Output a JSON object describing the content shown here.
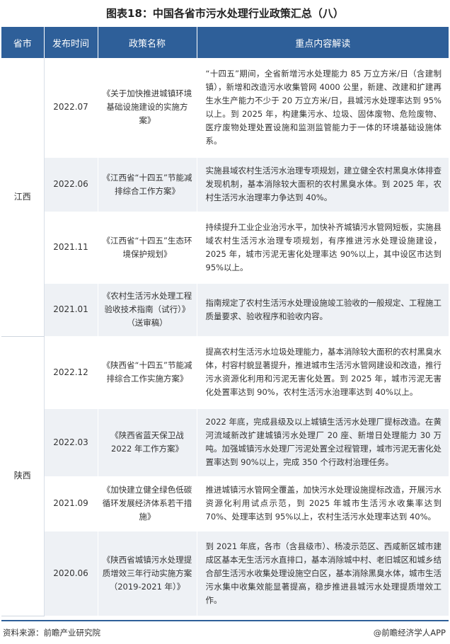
{
  "title": "图表18：中国各省市污水处理行业政策汇总（八）",
  "header": {
    "province": "省市",
    "date": "发布时间",
    "policy": "政策名称",
    "content": "重点内容解读"
  },
  "rows": [
    {
      "province": "江西",
      "date": "2022.07",
      "policy": "《关于加快推进城镇环境基础设施建设的实施方案》",
      "content": "“十四五”期间，全省新增污水处理能力 85 万立方米/日（含建制镇），新增和改造污水收集管网 4000 公里，新建、改建和扩建再生水生产能力不少于 20 万立方米/日，县城污水处理率达到 95%以上。到 2025 年，构建集污水、垃圾、固体废物、危险废物、医疗废物处理处置设施和监测监管能力于一体的环境基础设施体系。"
    },
    {
      "date": "2022.06",
      "policy": "《江西省“十四五”节能减排综合工作方案》",
      "content": "实施县域农村生活污水治理专项规划，建立健全农村黑臭水体排查发现机制，基本消除较大面积的农村黑臭水体。到 2025 年，农村生活污水治理率力争达到 40%。"
    },
    {
      "date": "2021.11",
      "policy": "《江西省“十四五”生态环境保护规划》",
      "content": "持续提升工业企业治污水平，加快补齐城镇污水管网短板，实施县域农村生活污水治理专项规划，有序推进污水处理设施建设，2025 年，城市污泥无害化处理率达 90%以上，其中设区市达到95%以上。"
    },
    {
      "date": "2021.01",
      "policy": "《农村生活污水处理工程验收技术指南（试行）》（送审稿）",
      "content": "指南规定了农村生活污水处理设施竣工验收的一般规定、工程施工质量要求、验收程序和验收内容。"
    },
    {
      "province": "陕西",
      "date": "2022.12",
      "policy": "《陕西省“十四五”节能减排综合工作实施方案》",
      "content": "提高农村生活污水垃圾处理能力，基本消除较大面积的农村黑臭水体，村容村貌显著提升，推进城市生活污水管网建设和改造，推行污水资源化利用和污泥无害化处置。到 2025 年，城市污泥无害化处置率达到 90%，农村生活污水治理率达到 40%以上。"
    },
    {
      "date": "2022.03",
      "policy": "《陕西省蓝天保卫战2022 年工作方案》",
      "content": "2022 年底，完成县级及以上城镇生活污水处理厂提标改造。在黄河流域新改扩建城镇污水处理厂 20 座、新增日处理能力 30 万吨。加强城镇污水处理厂污泥处置全过程管理，城市污泥无害化处置率达到 90%以上，完成 350 个行政村治理任务。"
    },
    {
      "date": "2021.09",
      "policy": "《加快建立健全绿色低碳循环发展经济体系若干措施》",
      "content": "推进城镇污水管网全覆盖，加快污水处理设施提标改造，开展污水资源化利用试点示范，到 2025 年城市生活污水收集率达到 70%、处理率达到 95%以上，农村生活污水处理率达到 40%。"
    },
    {
      "date": "2020.06",
      "policy": "《陕西省城镇污水处理提质增效三年行动实施方案（2019-2021 年）》",
      "content": "到 2021 年底，各市（含县级市）、杨凌示范区、西咸新区城市建成区基本无生活污水直排口，基本消除城中村、老旧城区和城乡结合部生活污水收集处理设施空白区，基本消除黑臭水体，城市生活污水集中收集效能显著提高，稳步推进县城污水处理提质增效工作。"
    }
  ],
  "footer": {
    "source": "资料来源：前瞻产业研究院",
    "brand": "@前瞻经济学人APP"
  }
}
